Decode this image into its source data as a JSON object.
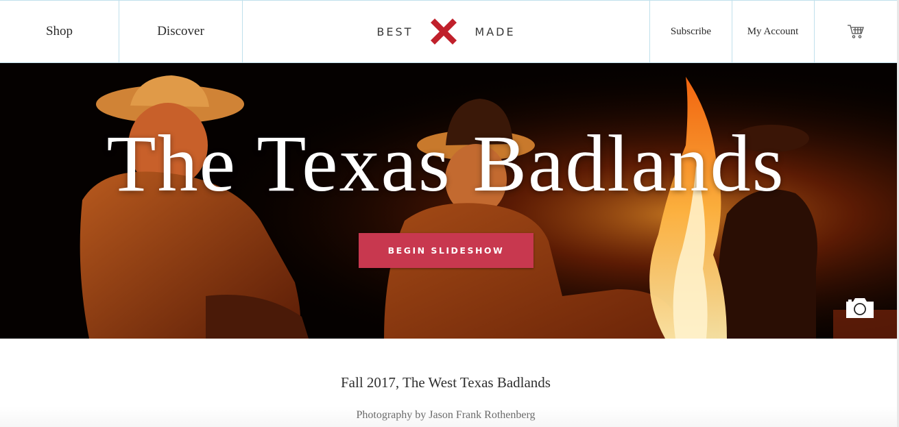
{
  "header": {
    "nav_left": [
      {
        "label": "Shop"
      },
      {
        "label": "Discover"
      }
    ],
    "brand": {
      "left_word": "BEST",
      "right_word": "MADE",
      "mark_color": "#c0202b"
    },
    "nav_right": [
      {
        "label": "Subscribe"
      },
      {
        "label": "My Account"
      }
    ],
    "cart_icon": "shopping-cart-icon"
  },
  "hero": {
    "title": "The Texas Badlands",
    "button_label": "BEGIN SLIDESHOW",
    "button_color": "#c8384f",
    "camera_icon": "camera-icon"
  },
  "article": {
    "subtitle": "Fall 2017, The West Texas Badlands",
    "credit": "Photography by Jason Frank Rothenberg"
  }
}
